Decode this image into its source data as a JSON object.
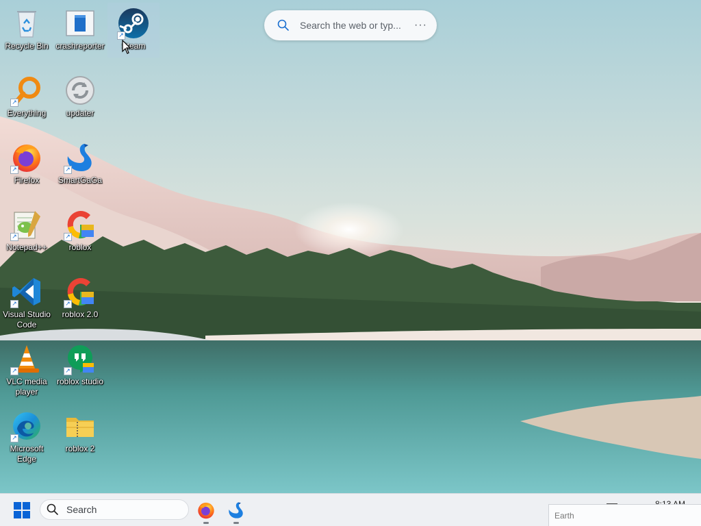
{
  "desktop": {
    "icons": [
      {
        "id": "recycle-bin",
        "label": "Recycle Bin",
        "icon": "recycle-bin-icon",
        "shortcut": false,
        "selected": false
      },
      {
        "id": "crashreporter",
        "label": "crashreporter",
        "icon": "app-window-icon",
        "shortcut": false,
        "selected": false
      },
      {
        "id": "steam",
        "label": "Steam",
        "icon": "steam-icon",
        "shortcut": true,
        "selected": true
      },
      {
        "id": "everything",
        "label": "Everything",
        "icon": "magnifier-icon",
        "shortcut": true,
        "selected": false
      },
      {
        "id": "updater",
        "label": "updater",
        "icon": "refresh-icon",
        "shortcut": false,
        "selected": false
      },
      {
        "id": "firefox",
        "label": "Firefox",
        "icon": "firefox-icon",
        "shortcut": true,
        "selected": false
      },
      {
        "id": "smartgaga",
        "label": "SmartGaGa",
        "icon": "swan-icon",
        "shortcut": true,
        "selected": false
      },
      {
        "id": "notepadpp",
        "label": "Notepad++",
        "icon": "notepad-plus-plus-icon",
        "shortcut": true,
        "selected": false
      },
      {
        "id": "roblox",
        "label": "roblox",
        "icon": "google-g-icon",
        "shortcut": true,
        "selected": false
      },
      {
        "id": "vscode",
        "label": "Visual Studio Code",
        "icon": "vscode-icon",
        "shortcut": true,
        "selected": false
      },
      {
        "id": "roblox2",
        "label": "roblox 2.0",
        "icon": "google-g-icon",
        "shortcut": true,
        "selected": false
      },
      {
        "id": "vlc",
        "label": "VLC media player",
        "icon": "vlc-cone-icon",
        "shortcut": true,
        "selected": false
      },
      {
        "id": "robloxstudio",
        "label": "roblox studio",
        "icon": "hangouts-icon",
        "shortcut": true,
        "selected": false
      },
      {
        "id": "edge",
        "label": "Microsoft Edge",
        "icon": "edge-icon",
        "shortcut": true,
        "selected": false
      },
      {
        "id": "roblox2folder",
        "label": "roblox 2",
        "icon": "zip-folder-icon",
        "shortcut": false,
        "selected": false
      }
    ]
  },
  "top_search": {
    "placeholder": "Search the web or typ...",
    "more": "···"
  },
  "taskbar": {
    "search_label": "Search",
    "apps": [
      {
        "name": "Firefox",
        "icon": "firefox-icon",
        "running": true
      },
      {
        "name": "SmartGaGa",
        "icon": "swan-icon",
        "running": true
      }
    ],
    "clock": "8:13 AM",
    "popup_text": "Earth"
  },
  "colors": {
    "taskbar_bg": "#eef0f3",
    "windows_blue": "#0a64d6",
    "selection": "#b4cde1"
  }
}
